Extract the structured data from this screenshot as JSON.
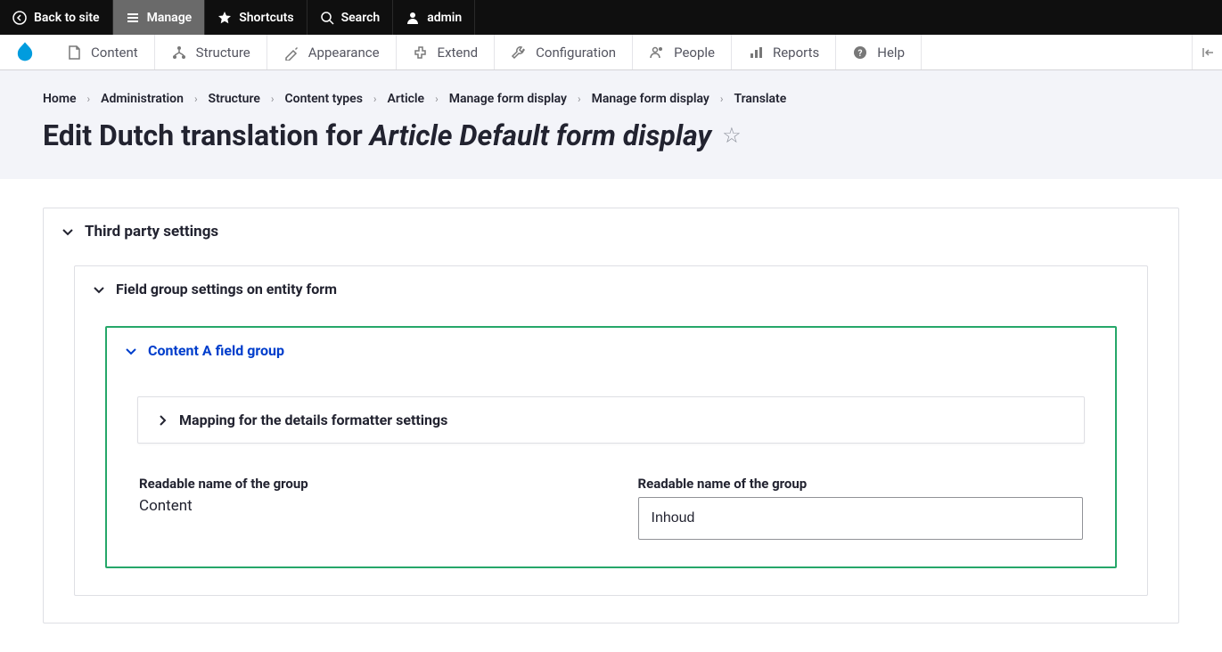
{
  "toolbar_top": {
    "back": "Back to site",
    "manage": "Manage",
    "shortcuts": "Shortcuts",
    "search": "Search",
    "user": "admin"
  },
  "toolbar_second": {
    "content": "Content",
    "structure": "Structure",
    "appearance": "Appearance",
    "extend": "Extend",
    "configuration": "Configuration",
    "people": "People",
    "reports": "Reports",
    "help": "Help"
  },
  "breadcrumb": {
    "home": "Home",
    "administration": "Administration",
    "structure": "Structure",
    "content_types": "Content types",
    "article": "Article",
    "manage_form_display": "Manage form display",
    "manage_form_display2": "Manage form display",
    "translate": "Translate"
  },
  "page_title": {
    "prefix": "Edit Dutch translation for ",
    "emphasis": "Article Default form display"
  },
  "details": {
    "third_party": "Third party settings",
    "field_group_settings": "Field group settings on entity form",
    "content_a": "Content A field group",
    "mapping": "Mapping for the details formatter settings"
  },
  "form": {
    "label_source": "Readable name of the group",
    "value_source": "Content",
    "label_target": "Readable name of the group",
    "value_target": "Inhoud"
  }
}
